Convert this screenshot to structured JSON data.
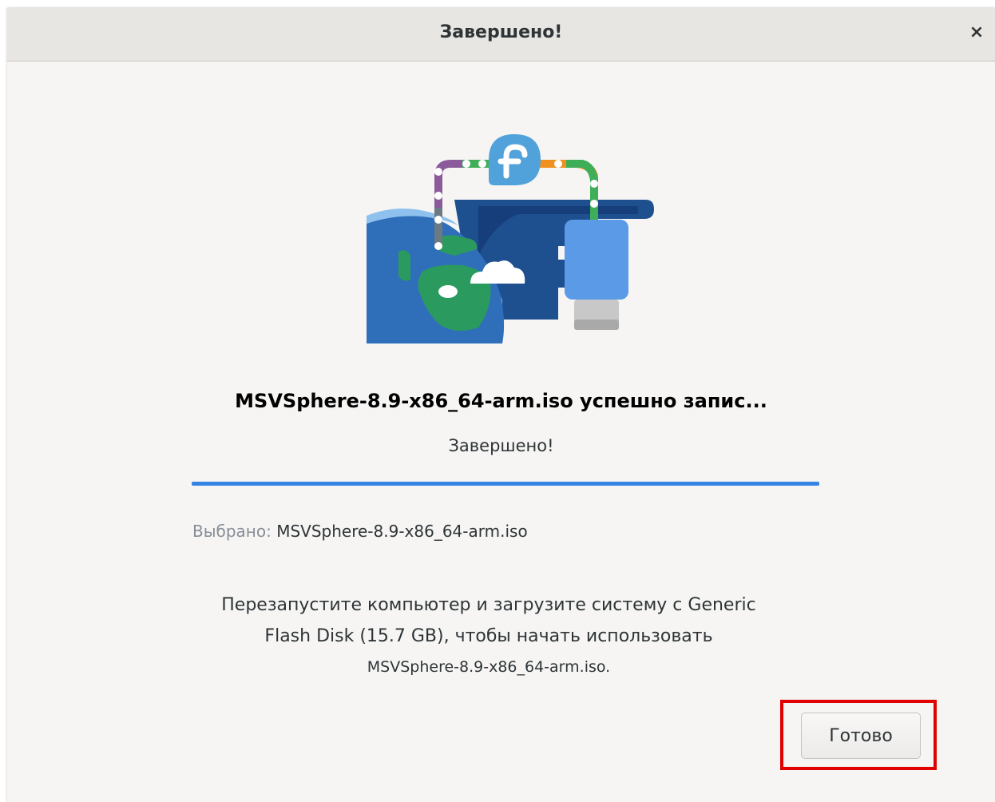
{
  "window": {
    "title": "Завершено!",
    "close_glyph": "×"
  },
  "headline": "MSVSphere-8.9-x86_64-arm.iso успешно запис...",
  "status": "Завершено!",
  "progress": {
    "percent": 100,
    "color": "#3584e4"
  },
  "selected": {
    "label": "Выбрано:",
    "value": "MSVSphere-8.9-x86_64-arm.iso"
  },
  "info": {
    "line1": "Перезапустите компьютер и загрузите систему с Generic",
    "line2": "Flash Disk (15.7 GB), чтобы начать использовать",
    "line3": "MSVSphere-8.9-x86_64-arm.iso."
  },
  "buttons": {
    "done": "Готово"
  },
  "icons": {
    "illustration": "fedora-media-writer-illustration-icon",
    "close": "close-icon"
  },
  "colors": {
    "accent": "#3584e4",
    "highlight": "#e00000"
  }
}
